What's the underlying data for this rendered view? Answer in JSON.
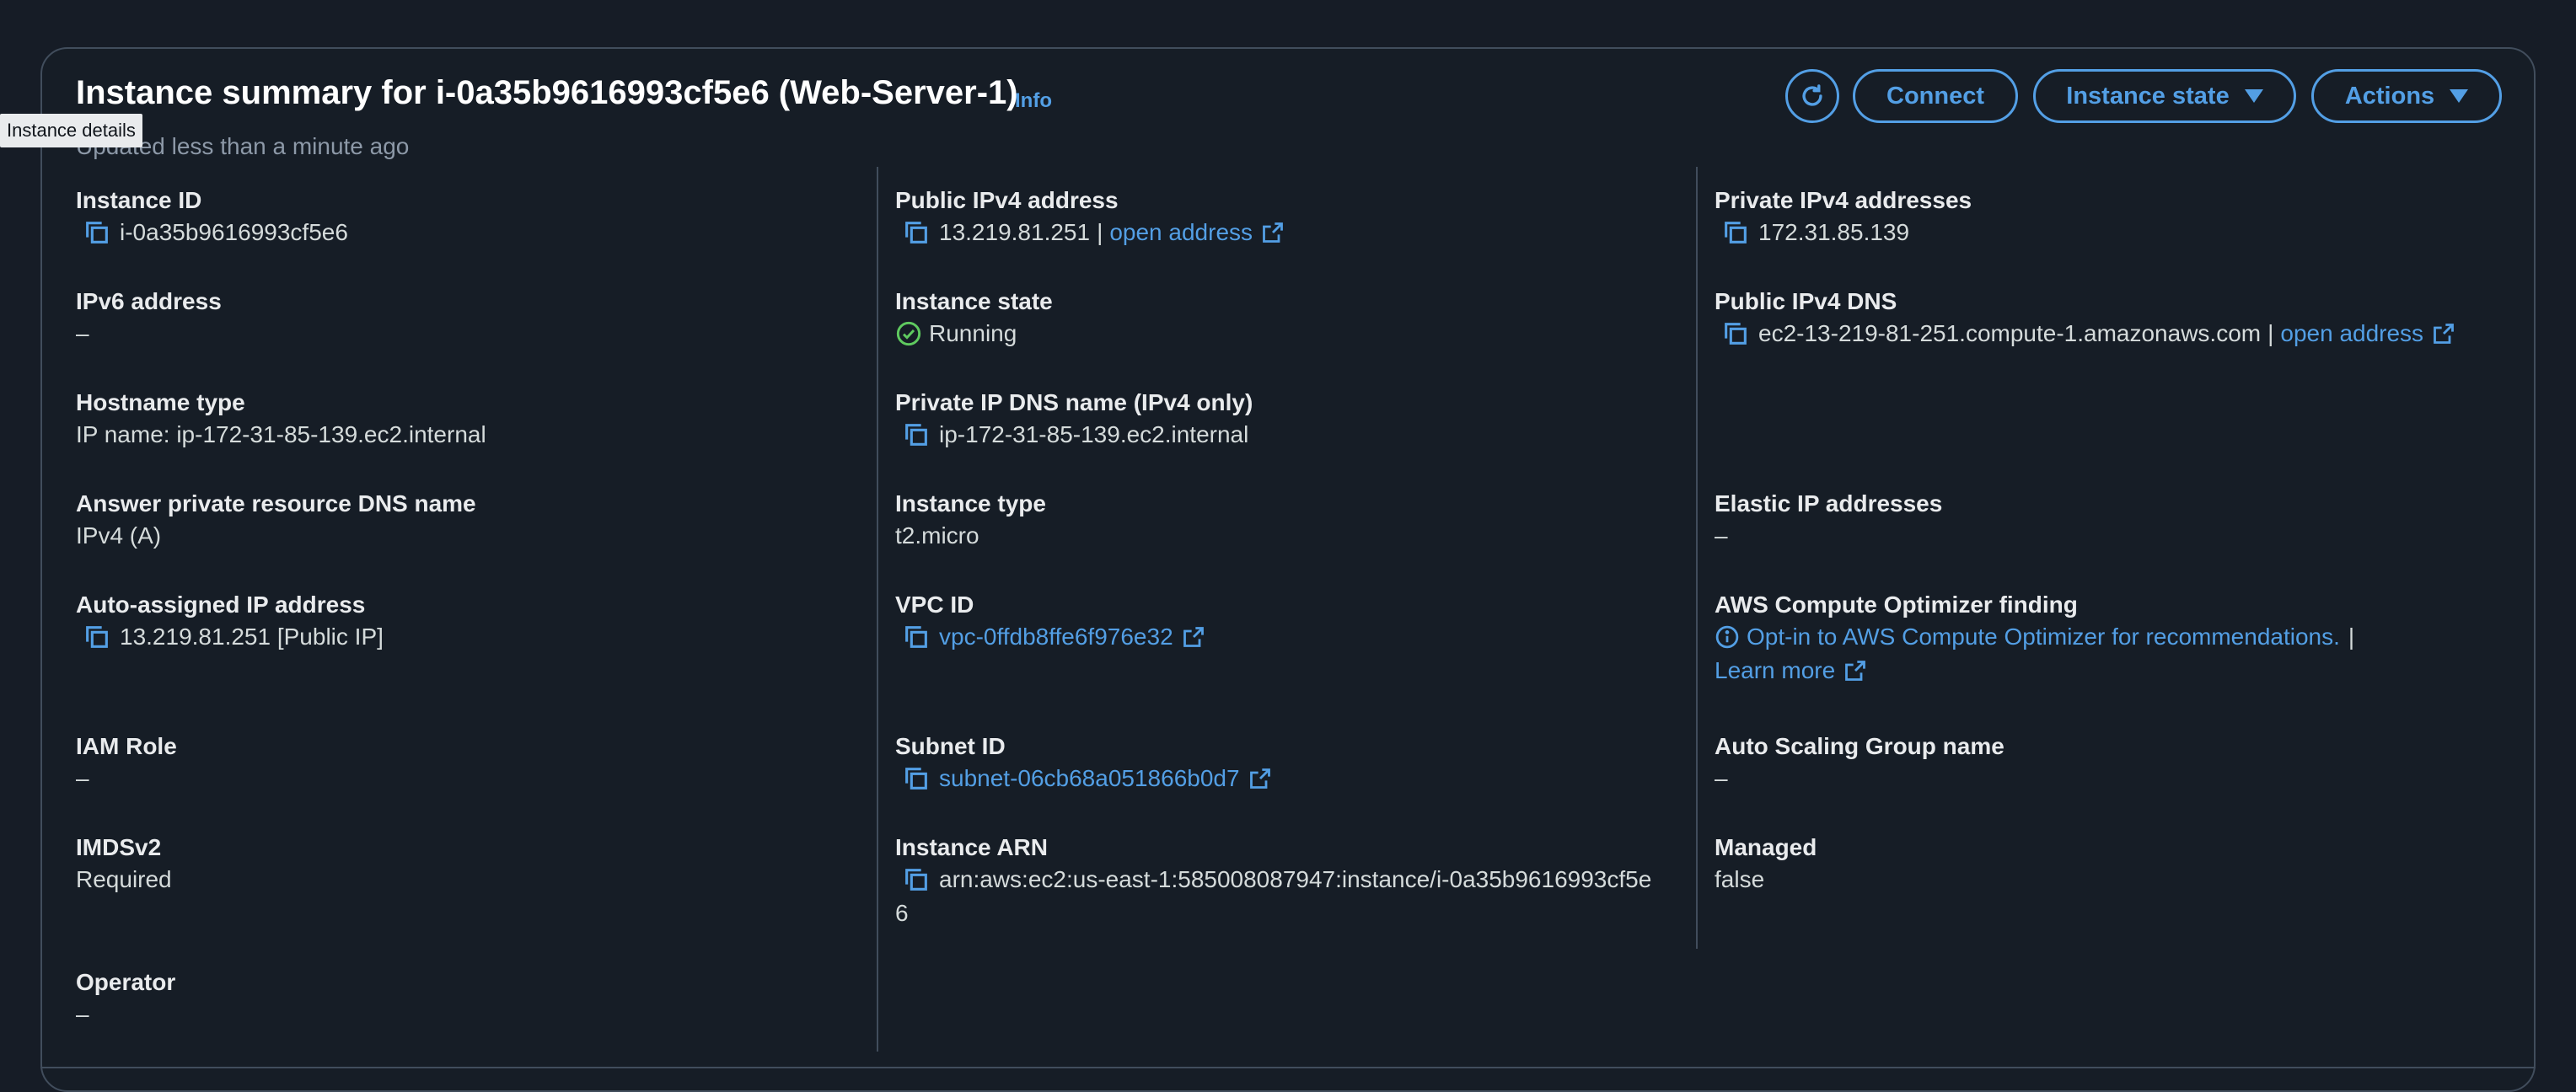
{
  "tooltip": "Instance details",
  "header": {
    "title": "Instance summary for i-0a35b9616993cf5e6 (Web-Server-1)",
    "info": "Info",
    "subtitle": "Updated less than a minute ago",
    "connect_label": "Connect",
    "instance_state_label": "Instance state",
    "actions_label": "Actions"
  },
  "col1": {
    "instance_id": {
      "label": "Instance ID",
      "value": "i-0a35b9616993cf5e6"
    },
    "ipv6": {
      "label": "IPv6 address",
      "value": "–"
    },
    "hostname_type": {
      "label": "Hostname type",
      "value": "IP name: ip-172-31-85-139.ec2.internal"
    },
    "answer_dns": {
      "label": "Answer private resource DNS name",
      "value": "IPv4 (A)"
    },
    "auto_ip": {
      "label": "Auto-assigned IP address",
      "value": "13.219.81.251 [Public IP]"
    },
    "iam_role": {
      "label": "IAM Role",
      "value": "–"
    },
    "imdsv2": {
      "label": "IMDSv2",
      "value": "Required"
    },
    "operator": {
      "label": "Operator",
      "value": "–"
    }
  },
  "col2": {
    "public_ipv4": {
      "label": "Public IPv4 address",
      "value": "13.219.81.251",
      "sep": "|",
      "link": "open address"
    },
    "instance_state": {
      "label": "Instance state",
      "value": "Running"
    },
    "private_dns": {
      "label": "Private IP DNS name (IPv4 only)",
      "value": "ip-172-31-85-139.ec2.internal"
    },
    "instance_type": {
      "label": "Instance type",
      "value": "t2.micro"
    },
    "vpc_id": {
      "label": "VPC ID",
      "value": "vpc-0ffdb8ffe6f976e32"
    },
    "subnet_id": {
      "label": "Subnet ID",
      "value": "subnet-06cb68a051866b0d7"
    },
    "arn": {
      "label": "Instance ARN",
      "value_line1": "arn:aws:ec2:us-east-1:585008087947:instance/i-0a35b9616993cf5e",
      "value_line2": "6"
    }
  },
  "col3": {
    "private_ipv4": {
      "label": "Private IPv4 addresses",
      "value": "172.31.85.139"
    },
    "public_dns": {
      "label": "Public IPv4 DNS",
      "value": "ec2-13-219-81-251.compute-1.amazonaws.com",
      "sep": "|",
      "link": "open address"
    },
    "elastic_ip": {
      "label": "Elastic IP addresses",
      "value": "–"
    },
    "optimizer": {
      "label": "AWS Compute Optimizer finding",
      "link": "Opt-in to AWS Compute Optimizer for recommendations.",
      "sep": "|",
      "learn_more": "Learn more"
    },
    "asg": {
      "label": "Auto Scaling Group name",
      "value": "–"
    },
    "managed": {
      "label": "Managed",
      "value": "false"
    }
  },
  "colors": {
    "link": "#539fe5",
    "running": "#5fca5f",
    "background": "#161d26",
    "border": "#414d5c"
  }
}
